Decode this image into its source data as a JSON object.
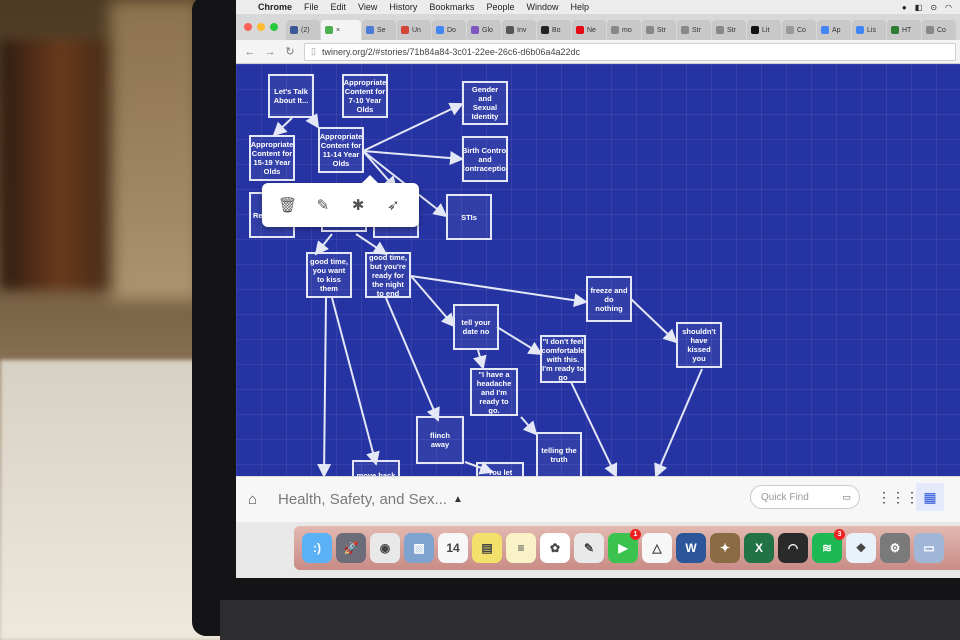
{
  "menubar": {
    "apple_icon": "apple-logo-icon",
    "app_name": "Chrome",
    "items": [
      "File",
      "Edit",
      "View",
      "History",
      "Bookmarks",
      "People",
      "Window",
      "Help"
    ]
  },
  "tabs": [
    {
      "label": "(2)",
      "color": "#3b5998"
    },
    {
      "label": "×",
      "color": "#4caf50",
      "active": true
    },
    {
      "label": "Se",
      "color": "#4a7bd6"
    },
    {
      "label": "Un",
      "color": "#d44638"
    },
    {
      "label": "Do",
      "color": "#4285f4"
    },
    {
      "label": "Glo",
      "color": "#7e57c2"
    },
    {
      "label": "Inv",
      "color": "#555555"
    },
    {
      "label": "Bo",
      "color": "#222222"
    },
    {
      "label": "Ne",
      "color": "#e50914"
    },
    {
      "label": "mo",
      "color": "#888888"
    },
    {
      "label": "Str",
      "color": "#888888"
    },
    {
      "label": "Str",
      "color": "#888888"
    },
    {
      "label": "Str",
      "color": "#888888"
    },
    {
      "label": "Lit",
      "color": "#111111"
    },
    {
      "label": "Co",
      "color": "#999999"
    },
    {
      "label": "Ap",
      "color": "#4285f4"
    },
    {
      "label": "Lis",
      "color": "#4285f4"
    },
    {
      "label": "HT",
      "color": "#2e7d32"
    },
    {
      "label": "Co",
      "color": "#888888"
    }
  ],
  "toolbar": {
    "url": "twinery.org/2/#stories/71b84a84-3c01-22ee-26c6-d6b06a4a22dc"
  },
  "passages": [
    {
      "id": "p1",
      "text": "Let's Talk About It..."
    },
    {
      "id": "p2",
      "text": "Appropriate Content for 7-10 Year Olds"
    },
    {
      "id": "p3",
      "text": "Gender and Sexual Identity"
    },
    {
      "id": "p4",
      "text": "Appropriate Content for 15-19 Year Olds"
    },
    {
      "id": "p5",
      "text": "Appropriate Content for 11-14 Year Olds"
    },
    {
      "id": "p6",
      "text": "Birth Control and Contraception"
    },
    {
      "id": "p7",
      "text": "Re"
    },
    {
      "id": "p8",
      "text": ""
    },
    {
      "id": "p9",
      "text": ""
    },
    {
      "id": "p10",
      "text": "STIs"
    },
    {
      "id": "p11",
      "text": "good time, you want to kiss them"
    },
    {
      "id": "p12",
      "text": "good time, but you're ready for the night to end"
    },
    {
      "id": "p13",
      "text": "freeze and do nothing"
    },
    {
      "id": "p14",
      "text": "tell your date no"
    },
    {
      "id": "p15",
      "text": "\"I don't feel comfortable with this. I'm ready to go"
    },
    {
      "id": "p16",
      "text": "shouldn't have kissed you"
    },
    {
      "id": "p17",
      "text": "\"I have a headache and I'm ready to go."
    },
    {
      "id": "p18",
      "text": "flinch away"
    },
    {
      "id": "p19",
      "text": "telling the truth"
    },
    {
      "id": "p20",
      "text": "move back"
    },
    {
      "id": "p21",
      "text": "You let your"
    }
  ],
  "passage_toolbar": {
    "icons": [
      "trash-icon",
      "pencil-icon",
      "bug-icon",
      "rocket-icon"
    ]
  },
  "storybar": {
    "home_icon": "home-icon",
    "title": "Health, Safety, and Sex...",
    "caret": "▲",
    "quickfind_placeholder": "Quick Find",
    "view_icons": [
      "grid-small-icon",
      "grid-large-icon"
    ]
  },
  "dock": {
    "apps": [
      {
        "name": "finder-icon",
        "color": "#5ab1f5",
        "glyph": ":)"
      },
      {
        "name": "launchpad-icon",
        "color": "#6d6d7a",
        "glyph": "🚀"
      },
      {
        "name": "chrome-icon",
        "color": "#e8e8e8",
        "glyph": "◉"
      },
      {
        "name": "preview-icon",
        "color": "#7fa3cf",
        "glyph": "▧"
      },
      {
        "name": "calendar-icon",
        "color": "#f7f7f7",
        "glyph": "14"
      },
      {
        "name": "stickies-icon",
        "color": "#f2e06a",
        "glyph": "▤"
      },
      {
        "name": "notes-icon",
        "color": "#f8f2c6",
        "glyph": "≡"
      },
      {
        "name": "photos-icon",
        "color": "#ffffff",
        "glyph": "✿"
      },
      {
        "name": "textedit-icon",
        "color": "#e9e9e9",
        "glyph": "✎"
      },
      {
        "name": "facetime-icon",
        "color": "#3cc24e",
        "glyph": "▶",
        "badge": "1"
      },
      {
        "name": "google-drive-icon",
        "color": "#f7f7f7",
        "glyph": "△"
      },
      {
        "name": "word-icon",
        "color": "#2b579a",
        "glyph": "W"
      },
      {
        "name": "gimp-icon",
        "color": "#8b6b43",
        "glyph": "✦"
      },
      {
        "name": "excel-icon",
        "color": "#217346",
        "glyph": "X"
      },
      {
        "name": "scanner-icon",
        "color": "#2a2a2a",
        "glyph": "◠"
      },
      {
        "name": "spotify-icon",
        "color": "#1db954",
        "glyph": "≋",
        "badge": "3"
      },
      {
        "name": "dropbox-icon",
        "color": "#e9f1fb",
        "glyph": "❖"
      },
      {
        "name": "system-preferences-icon",
        "color": "#7a7a7a",
        "glyph": "⚙"
      },
      {
        "name": "screenshot-icon",
        "color": "#9fb6d6",
        "glyph": "▭"
      }
    ]
  },
  "colors": {
    "canvas": "#2633a3",
    "passage_border": "#e4e7f6",
    "active_view": "#2b55d8"
  }
}
